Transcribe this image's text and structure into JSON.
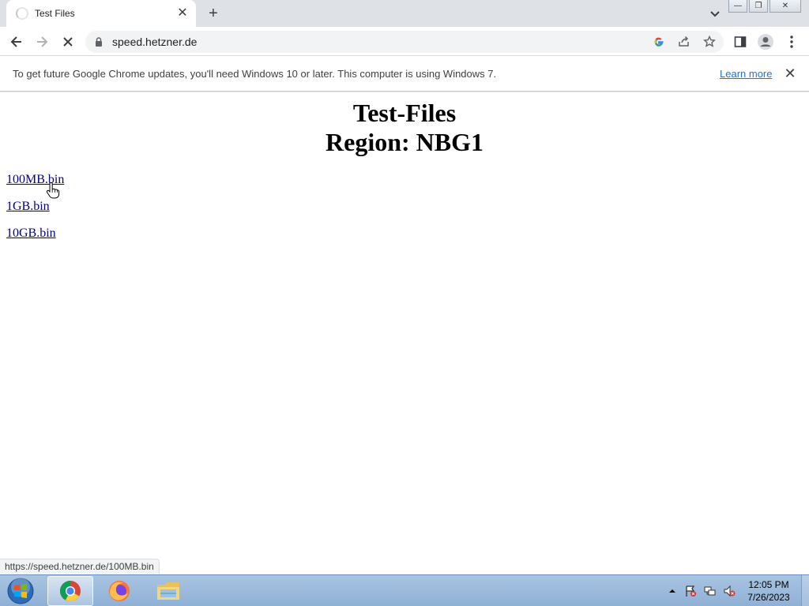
{
  "tab": {
    "title": "Test Files",
    "close": "✕",
    "new_tab": "+"
  },
  "window": {
    "minimize": "—",
    "restore": "❐",
    "close": "✕"
  },
  "toolbar": {
    "back": "←",
    "forward": "→",
    "stop": "✕",
    "url": "speed.hetzner.de"
  },
  "infobar": {
    "message": "To get future Google Chrome updates, you'll need Windows 10 or later. This computer is using Windows 7.",
    "learn_more": "Learn more",
    "close": "✕"
  },
  "page": {
    "heading_line1": "Test-Files",
    "heading_line2": "Region: NBG1",
    "files": [
      {
        "label": "100MB.bin"
      },
      {
        "label": "1GB.bin"
      },
      {
        "label": "10GB.bin"
      }
    ]
  },
  "status_bar": {
    "url": "https://speed.hetzner.de/100MB.bin"
  },
  "taskbar": {
    "time": "12:05 PM",
    "date": "7/26/2023"
  },
  "colors": {
    "tabstrip": "#dee1e6",
    "link": "#00008b",
    "learn_more": "#1a73e8",
    "taskbar": "#a9c4e2"
  }
}
